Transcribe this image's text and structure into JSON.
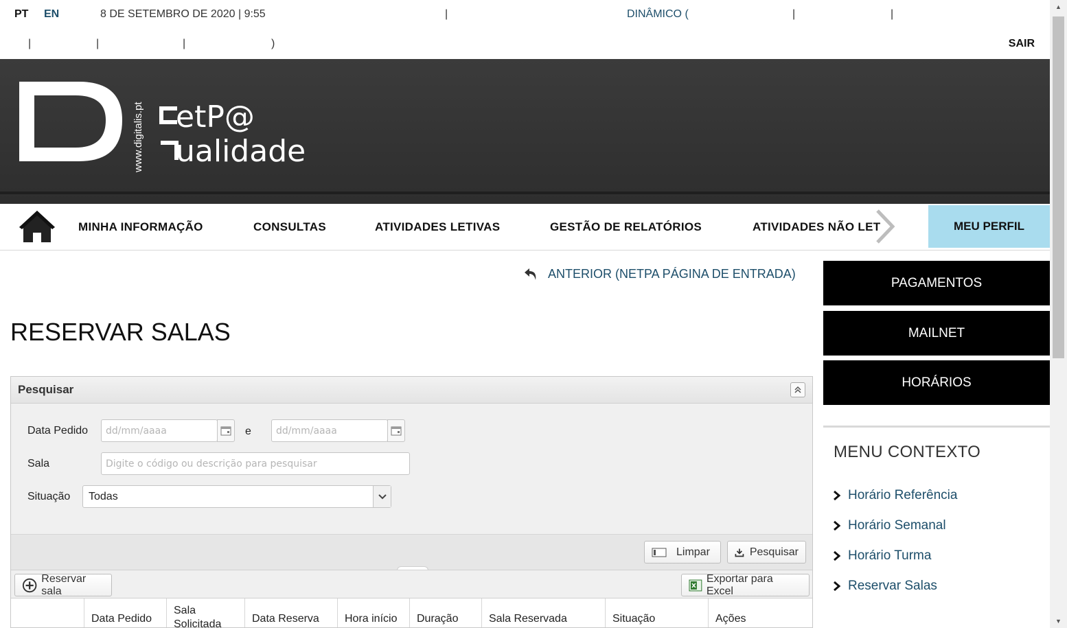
{
  "topbar": {
    "lang_pt": "PT",
    "lang_en": "EN",
    "datetime": "8 DE SETEMBRO DE 2020 | 9:55",
    "separator": "|",
    "dynamic_label": "DINÂMICO (",
    "closing_paren": ")",
    "logout": "SAIR"
  },
  "header": {
    "logo_site": "www.digitalis.pt",
    "logo_line1": "etP@",
    "logo_line2": "ualidade"
  },
  "nav": {
    "items": [
      "MINHA INFORMAÇÃO",
      "CONSULTAS",
      "ATIVIDADES LETIVAS",
      "GESTÃO DE RELATÓRIOS",
      "ATIVIDADES NÃO LET"
    ],
    "profile": "MEU PERFIL"
  },
  "back_link": "ANTERIOR (NETPA PÁGINA DE ENTRADA)",
  "page_title": "RESERVAR SALAS",
  "search_panel": {
    "title": "Pesquisar",
    "date_label": "Data Pedido",
    "date_placeholder": "dd/mm/aaaa",
    "and_label": "e",
    "room_label": "Sala",
    "room_placeholder": "Digite o código ou descrição para pesquisar",
    "status_label": "Situação",
    "status_value": "Todas",
    "clear_button": "Limpar",
    "search_button": "Pesquisar"
  },
  "toolbar": {
    "reserve_button": "Reservar sala",
    "export_button": "Exportar para Excel"
  },
  "grid": {
    "columns": [
      "Data Pedido",
      "Sala Solicitada",
      "Data Reserva",
      "Hora início",
      "Duração",
      "Sala Reservada",
      "Situação",
      "Ações"
    ]
  },
  "sidebar": {
    "buttons": [
      "PAGAMENTOS",
      "MAILNET",
      "HORÁRIOS"
    ],
    "context_title": "MENU CONTEXTO",
    "context_items": [
      "Horário Referência",
      "Horário Semanal",
      "Horário Turma",
      "Reservar Salas"
    ]
  },
  "colors": {
    "link": "#1d4e6a",
    "profile_bg": "#a9dcee",
    "header_bg": "#333333"
  }
}
